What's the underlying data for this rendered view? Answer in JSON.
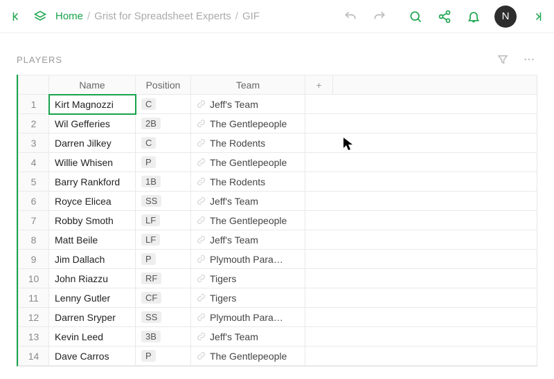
{
  "topbar": {
    "home_label": "Home",
    "crumb1": "Grist for Spreadsheet Experts",
    "crumb2": "GIF",
    "avatar_initial": "N"
  },
  "section": {
    "title": "PLAYERS",
    "add_col": "+"
  },
  "columns": {
    "name": "Name",
    "position": "Position",
    "team": "Team"
  },
  "rows": [
    {
      "n": "1",
      "name": "Kirt Magnozzi",
      "pos": "C",
      "team": "Jeff's Team"
    },
    {
      "n": "2",
      "name": "Wil Gefferies",
      "pos": "2B",
      "team": "The Gentlepeople"
    },
    {
      "n": "3",
      "name": "Darren Jilkey",
      "pos": "C",
      "team": "The Rodents"
    },
    {
      "n": "4",
      "name": "Willie Whisen",
      "pos": "P",
      "team": "The Gentlepeople"
    },
    {
      "n": "5",
      "name": "Barry Rankford",
      "pos": "1B",
      "team": "The Rodents"
    },
    {
      "n": "6",
      "name": "Royce Elicea",
      "pos": "SS",
      "team": "Jeff's Team"
    },
    {
      "n": "7",
      "name": "Robby Smoth",
      "pos": "LF",
      "team": "The Gentlepeople"
    },
    {
      "n": "8",
      "name": "Matt Beile",
      "pos": "LF",
      "team": "Jeff's Team"
    },
    {
      "n": "9",
      "name": "Jim Dallach",
      "pos": "P",
      "team": "Plymouth Para…"
    },
    {
      "n": "10",
      "name": "John Riazzu",
      "pos": "RF",
      "team": "Tigers"
    },
    {
      "n": "11",
      "name": "Lenny Gutler",
      "pos": "CF",
      "team": "Tigers"
    },
    {
      "n": "12",
      "name": "Darren Sryper",
      "pos": "SS",
      "team": "Plymouth Para…"
    },
    {
      "n": "13",
      "name": "Kevin Leed",
      "pos": "3B",
      "team": "Jeff's Team"
    },
    {
      "n": "14",
      "name": "Dave Carros",
      "pos": "P",
      "team": "The Gentlepeople"
    }
  ],
  "selected_row": 0
}
